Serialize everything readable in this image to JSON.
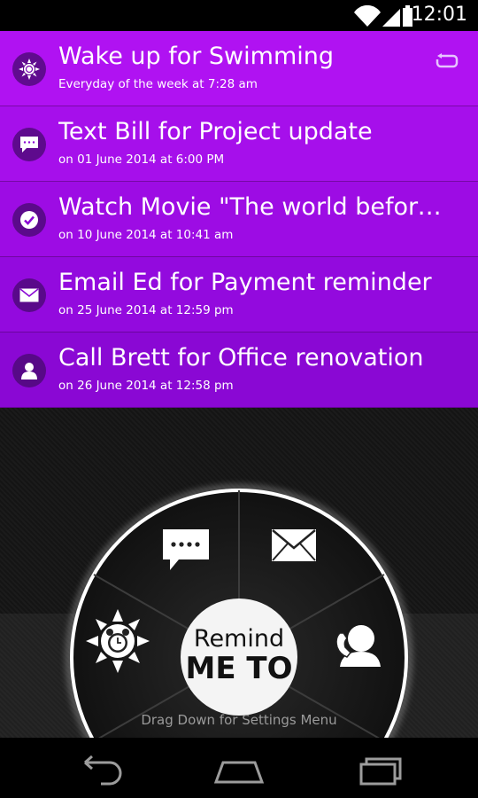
{
  "status_bar": {
    "time": "12:01"
  },
  "reminders": [
    {
      "title": "Wake up for Swimming",
      "subtitle": "Everyday of the week at 7:28 am",
      "icon": "alarm-sun-icon",
      "repeat": true
    },
    {
      "title": "Text Bill for Project update",
      "subtitle": "on 01 June 2014 at 6:00 PM",
      "icon": "chat-bubble-icon"
    },
    {
      "title": "Watch Movie \"The world before h...",
      "subtitle": "on 10 June 2014 at 10:41 am",
      "icon": "check-circle-icon"
    },
    {
      "title": "Email Ed for Payment reminder",
      "subtitle": "on 25 June 2014 at 12:59 pm",
      "icon": "envelope-icon"
    },
    {
      "title": "Call Brett for Office renovation",
      "subtitle": "on 26 June 2014 at 12:58 pm",
      "icon": "contact-icon"
    }
  ],
  "dial": {
    "center_line1": "Remind",
    "center_line2": "ME TO",
    "hint": "Drag Down for Settings Menu"
  },
  "colors": {
    "row_colors": [
      "#b012f2",
      "#a60feb",
      "#9d0ce4",
      "#930ade",
      "#8a08d4"
    ],
    "accent": "#a30ff0"
  }
}
